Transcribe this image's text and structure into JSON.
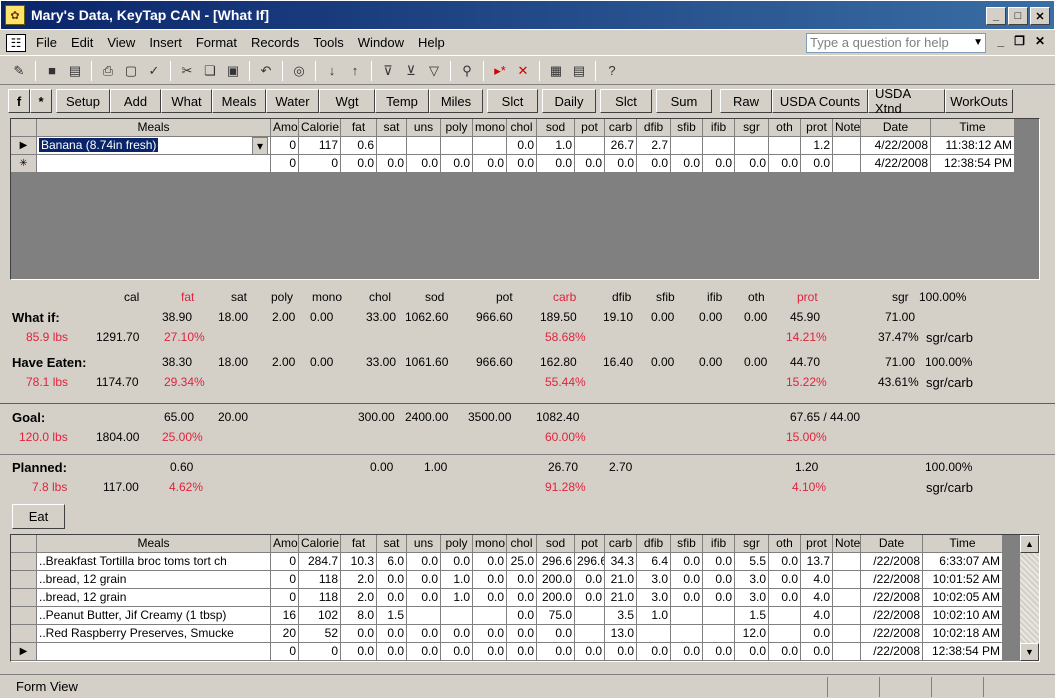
{
  "window": {
    "title": "Mary's Data, KeyTap CAN - [What If]"
  },
  "menu": {
    "items": [
      "File",
      "Edit",
      "View",
      "Insert",
      "Format",
      "Records",
      "Tools",
      "Window",
      "Help"
    ],
    "help_placeholder": "Type a question for help"
  },
  "buttons": [
    "f",
    "*",
    "Setup",
    "Add",
    "What",
    "Meals",
    "Water",
    "Wgt",
    "Temp",
    "Miles",
    "Slct",
    "Daily",
    "Slct",
    "Sum",
    "Raw",
    "USDA Counts",
    "USDA Xtnd",
    "WorkOuts"
  ],
  "columns": [
    "Meals",
    "Amo",
    "Calorie",
    "fat",
    "sat",
    "uns",
    "poly",
    "mono",
    "chol",
    "sod",
    "pot",
    "carb",
    "dfib",
    "sfib",
    "ifib",
    "sgr",
    "oth",
    "prot",
    "Note",
    "Date",
    "Time"
  ],
  "top_grid": {
    "rows": [
      {
        "marker": "▶",
        "cells": [
          "Banana (8.74in fresh)",
          "0",
          "117",
          "0.6",
          "",
          "",
          "",
          "",
          "0.0",
          "1.0",
          "",
          "26.7",
          "2.7",
          "",
          "",
          "",
          "",
          "1.2",
          "",
          "4/22/2008",
          "11:38:12 AM"
        ]
      },
      {
        "marker": "✳",
        "cells": [
          "",
          "0",
          "0",
          "0.0",
          "0.0",
          "0.0",
          "0.0",
          "0.0",
          "0.0",
          "0.0",
          "0.0",
          "0.0",
          "0.0",
          "0.0",
          "0.0",
          "0.0",
          "0.0",
          "0.0",
          "",
          "4/22/2008",
          "12:38:54 PM"
        ]
      }
    ]
  },
  "stats": {
    "headers": [
      "cal",
      "fat",
      "sat",
      "poly",
      "mono",
      "chol",
      "sod",
      "pot",
      "carb",
      "dfib",
      "sfib",
      "ifib",
      "oth",
      "prot",
      "sgr",
      "100.00%"
    ],
    "what_if": {
      "label": "What if:",
      "weight": "85.9 lbs",
      "cal": "1291.70",
      "fat": "38.90",
      "sat": "18.00",
      "poly": "2.00",
      "mono": "0.00",
      "chol": "33.00",
      "sod": "1062.60",
      "pot": "966.60",
      "carb": "189.50",
      "dfib": "19.10",
      "sfib": "0.00",
      "ifib": "0.00",
      "oth": "0.00",
      "prot": "45.90",
      "sgr": "71.00",
      "fat_pct": "27.10%",
      "carb_pct": "58.68%",
      "prot_pct": "14.21%",
      "sgr_pct": "37.47%",
      "sgr_label": "sgr/carb"
    },
    "have_eaten": {
      "label": "Have Eaten:",
      "weight": "78.1 lbs",
      "cal": "1174.70",
      "fat": "38.30",
      "sat": "18.00",
      "poly": "2.00",
      "mono": "0.00",
      "chol": "33.00",
      "sod": "1061.60",
      "pot": "966.60",
      "carb": "162.80",
      "dfib": "16.40",
      "sfib": "0.00",
      "ifib": "0.00",
      "oth": "0.00",
      "prot": "44.70",
      "sgr": "71.00",
      "total_pct": "100.00%",
      "fat_pct": "29.34%",
      "carb_pct": "55.44%",
      "prot_pct": "15.22%",
      "sgr_pct": "43.61%",
      "sgr_label": "sgr/carb"
    },
    "goal": {
      "label": "Goal:",
      "weight": "120.0 lbs",
      "cal": "1804.00",
      "fat": "65.00",
      "sat": "20.00",
      "chol": "300.00",
      "sod": "2400.00",
      "pot": "3500.00",
      "carb": "1082.40",
      "prot": "67.65 / 44.00",
      "fat_pct": "25.00%",
      "carb_pct": "60.00%",
      "prot_pct": "15.00%"
    },
    "planned": {
      "label": "Planned:",
      "weight": "7.8 lbs",
      "cal": "117.00",
      "fat": "0.60",
      "chol": "0.00",
      "sod": "1.00",
      "carb": "26.70",
      "dfib": "2.70",
      "prot": "1.20",
      "total_pct": "100.00%",
      "fat_pct": "4.62%",
      "carb_pct": "91.28%",
      "prot_pct": "4.10%",
      "sgr_label": "sgr/carb"
    }
  },
  "eat_button": "Eat",
  "bottom_grid": {
    "rows": [
      {
        "marker": "",
        "cells": [
          "..Breakfast Tortilla broc toms tort ch",
          "0",
          "284.7",
          "10.3",
          "6.0",
          "0.0",
          "0.0",
          "0.0",
          "25.0",
          "296.6",
          "296.6",
          "34.3",
          "6.4",
          "0.0",
          "0.0",
          "5.5",
          "0.0",
          "13.7",
          "",
          "/22/2008",
          "6:33:07 AM"
        ]
      },
      {
        "marker": "",
        "cells": [
          "..bread, 12 grain",
          "0",
          "118",
          "2.0",
          "0.0",
          "0.0",
          "1.0",
          "0.0",
          "0.0",
          "200.0",
          "0.0",
          "21.0",
          "3.0",
          "0.0",
          "0.0",
          "3.0",
          "0.0",
          "4.0",
          "",
          "/22/2008",
          "10:01:52 AM"
        ]
      },
      {
        "marker": "",
        "cells": [
          "..bread, 12 grain",
          "0",
          "118",
          "2.0",
          "0.0",
          "0.0",
          "1.0",
          "0.0",
          "0.0",
          "200.0",
          "0.0",
          "21.0",
          "3.0",
          "0.0",
          "0.0",
          "3.0",
          "0.0",
          "4.0",
          "",
          "/22/2008",
          "10:02:05 AM"
        ]
      },
      {
        "marker": "",
        "cells": [
          "..Peanut Butter, Jif Creamy (1 tbsp)",
          "16",
          "102",
          "8.0",
          "1.5",
          "",
          "",
          "",
          "0.0",
          "75.0",
          "",
          "3.5",
          "1.0",
          "",
          "",
          "1.5",
          "",
          "4.0",
          "",
          "/22/2008",
          "10:02:10 AM"
        ]
      },
      {
        "marker": "",
        "cells": [
          "..Red Raspberry Preserves, Smucke",
          "20",
          "52",
          "0.0",
          "0.0",
          "0.0",
          "0.0",
          "0.0",
          "0.0",
          "0.0",
          "",
          "13.0",
          "",
          "",
          "",
          "12.0",
          "",
          "0.0",
          "",
          "/22/2008",
          "10:02:18 AM"
        ]
      },
      {
        "marker": "▶",
        "cells": [
          "",
          "0",
          "0",
          "0.0",
          "0.0",
          "0.0",
          "0.0",
          "0.0",
          "0.0",
          "0.0",
          "0.0",
          "0.0",
          "0.0",
          "0.0",
          "0.0",
          "0.0",
          "0.0",
          "0.0",
          "",
          "/22/2008",
          "12:38:54 PM"
        ]
      }
    ]
  },
  "status": {
    "text": "Form View"
  },
  "icons": [
    "app-icon",
    "form-icon",
    "save-icon",
    "print-icon",
    "preview-icon",
    "spell-icon",
    "cut-icon",
    "copy-icon",
    "paste-icon",
    "undo-icon",
    "sort-asc-icon",
    "sort-desc-icon",
    "filter-icon",
    "find-icon",
    "new-record-icon",
    "delete-record-icon",
    "help-icon"
  ]
}
